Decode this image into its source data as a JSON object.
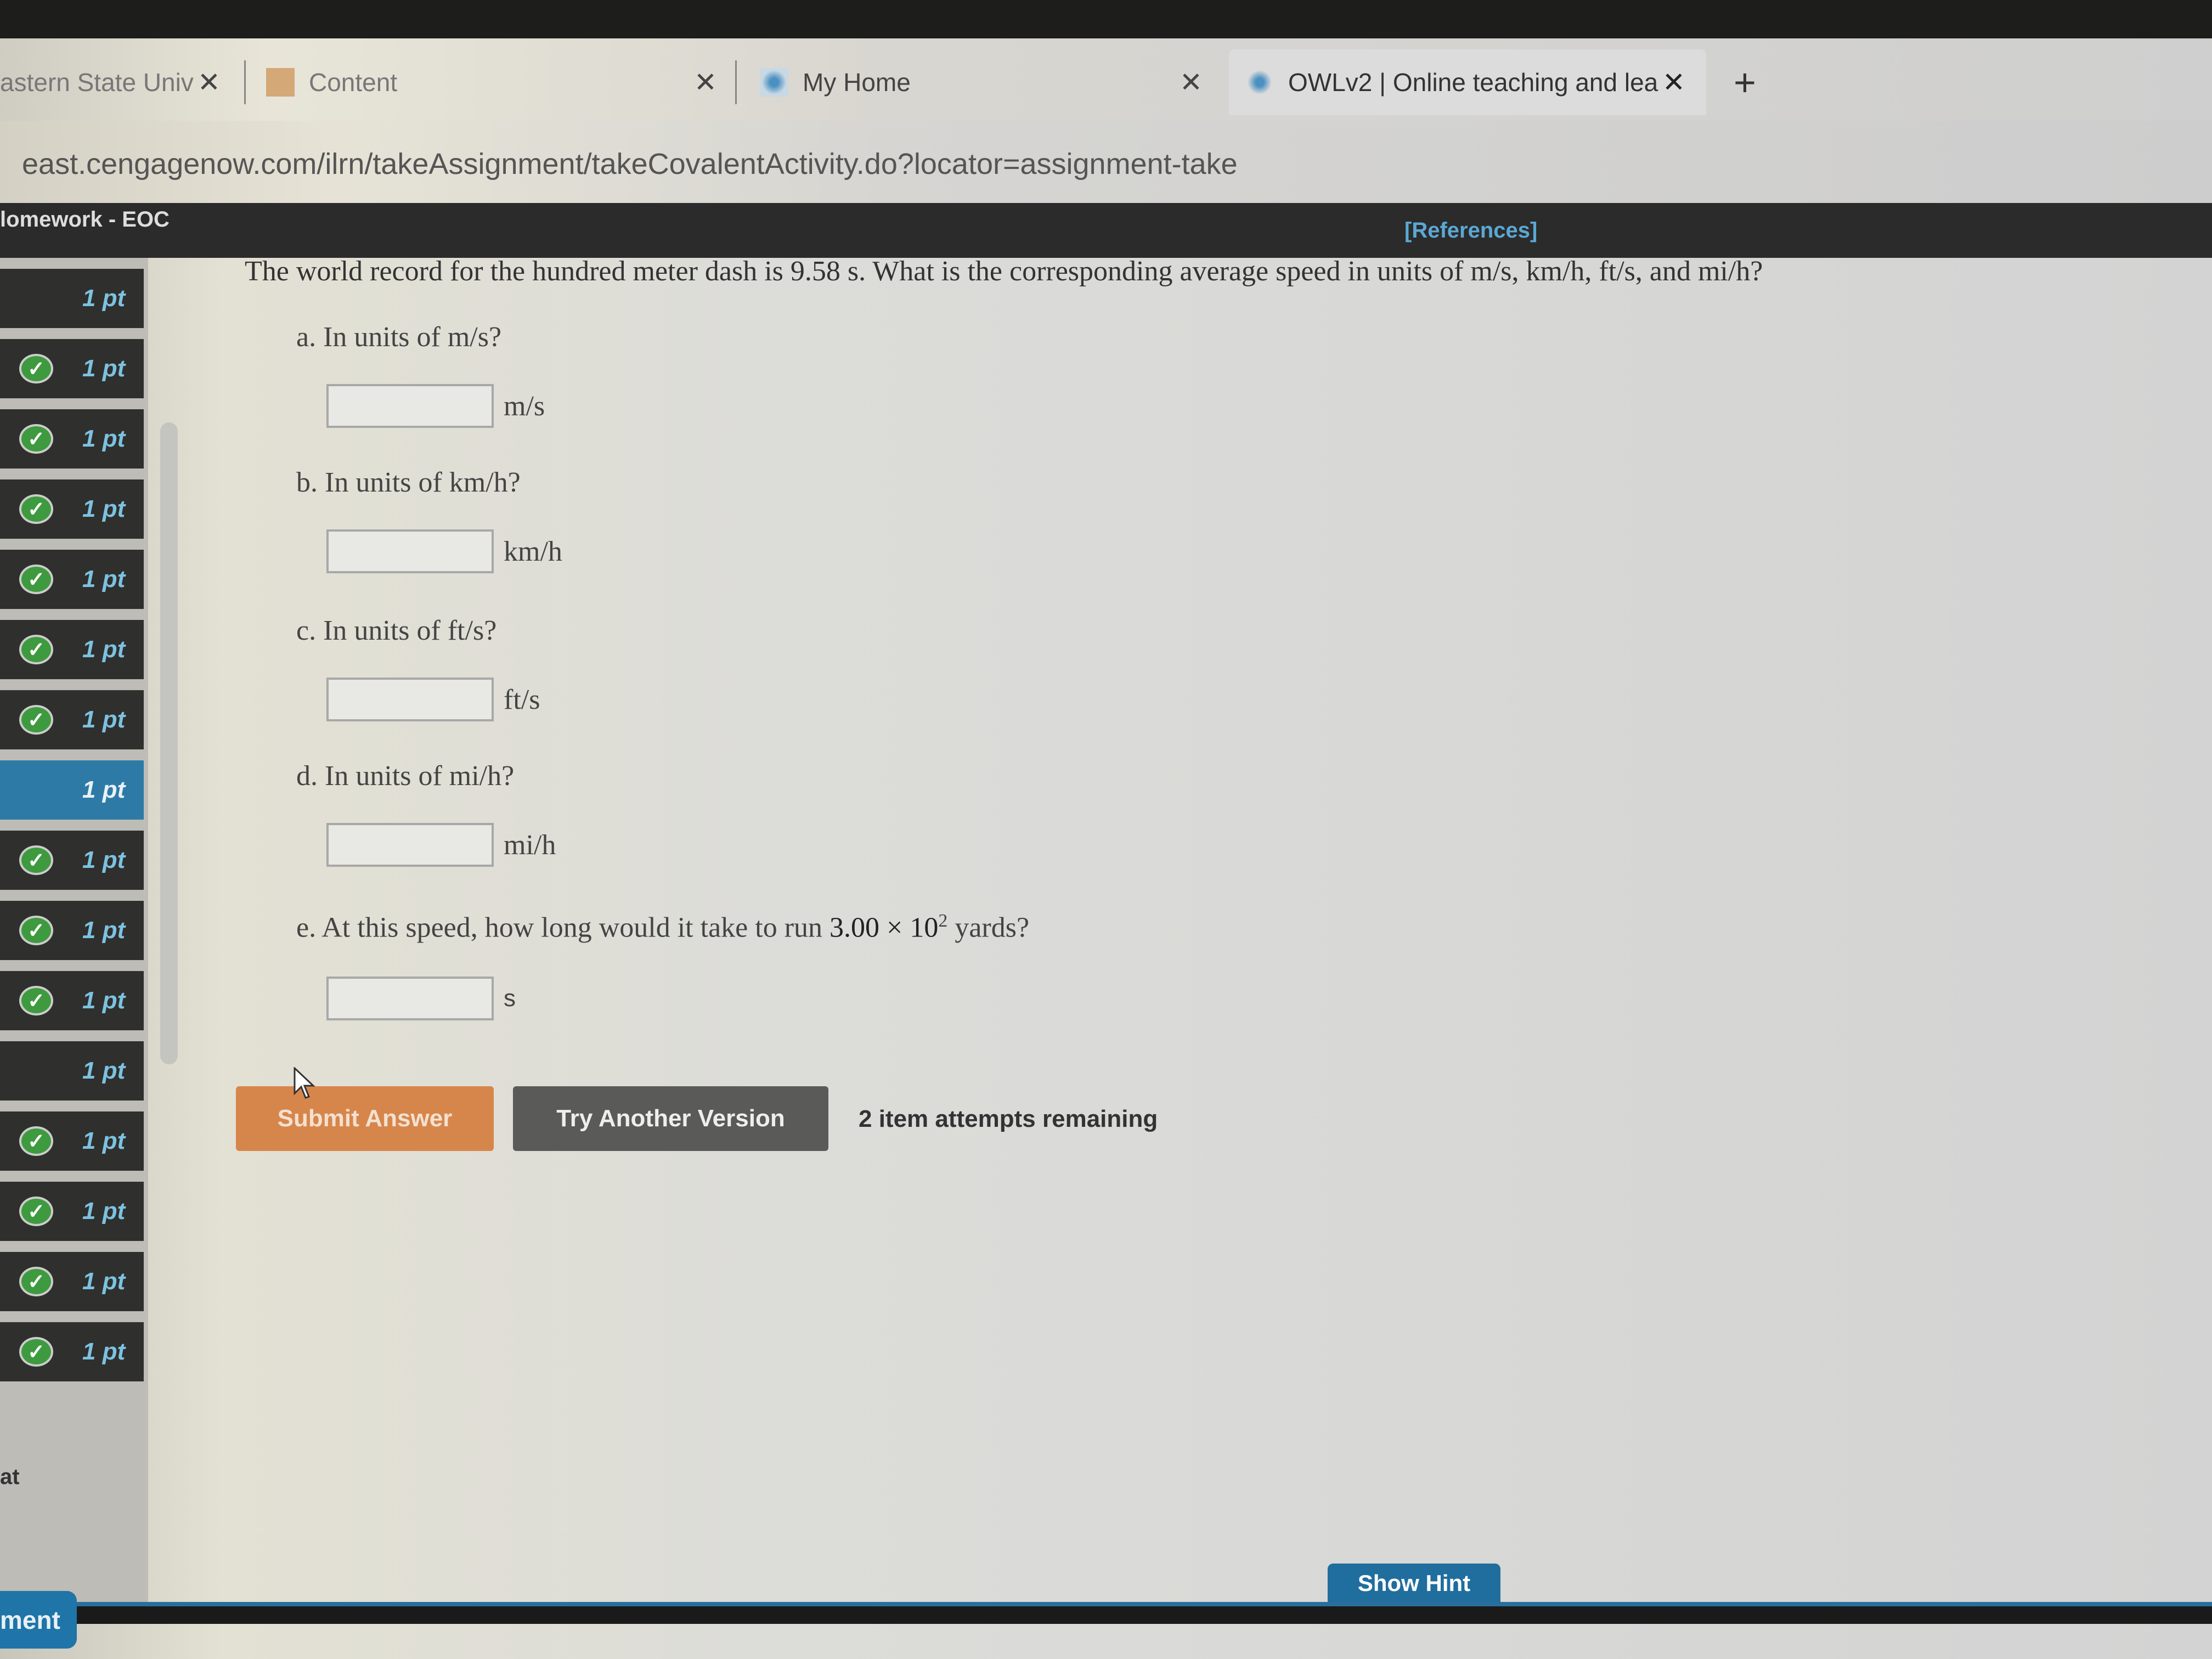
{
  "browser": {
    "tabs": [
      {
        "label": "astern State Univ",
        "active": false
      },
      {
        "label": "Content",
        "active": false
      },
      {
        "label": "My Home",
        "active": false
      },
      {
        "label": "OWLv2 | Online teaching and lea",
        "active": true
      }
    ],
    "close_glyph": "✕",
    "new_tab_glyph": "+",
    "url": "east.cengagenow.com/ilrn/takeAssignment/takeCovalentActivity.do?locator=assignment-take"
  },
  "header": {
    "title": "lomework - EOC",
    "references": "[References]"
  },
  "sidebar": {
    "items": [
      {
        "points": "1 pt",
        "status": "none"
      },
      {
        "points": "1 pt",
        "status": "correct"
      },
      {
        "points": "1 pt",
        "status": "correct"
      },
      {
        "points": "1 pt",
        "status": "correct"
      },
      {
        "points": "1 pt",
        "status": "correct"
      },
      {
        "points": "1 pt",
        "status": "correct"
      },
      {
        "points": "1 pt",
        "status": "correct"
      },
      {
        "points": "1 pt",
        "status": "current"
      },
      {
        "points": "1 pt",
        "status": "correct"
      },
      {
        "points": "1 pt",
        "status": "correct"
      },
      {
        "points": "1 pt",
        "status": "correct"
      },
      {
        "points": "1 pt",
        "status": "none"
      },
      {
        "points": "1 pt",
        "status": "correct"
      },
      {
        "points": "1 pt",
        "status": "correct"
      },
      {
        "points": "1 pt",
        "status": "correct"
      },
      {
        "points": "1 pt",
        "status": "correct"
      }
    ],
    "footer_text": "at",
    "bottom_button": "ment"
  },
  "question": {
    "text": "The world record for the hundred meter dash is 9.58 s. What is the corresponding average speed in units of m/s, km/h, ft/s, and mi/h?",
    "parts": [
      {
        "label": "a. In units of m/s?",
        "unit": "m/s",
        "value": ""
      },
      {
        "label": "b. In units of km/h?",
        "unit": "km/h",
        "value": ""
      },
      {
        "label": "c. In units of ft/s?",
        "unit": "ft/s",
        "value": ""
      },
      {
        "label": "d. In units of mi/h?",
        "unit": "mi/h",
        "value": ""
      },
      {
        "label_prefix": "e. At this speed, how long would it take to run ",
        "label_num": "3.00 × 10",
        "label_exp": "2",
        "label_suffix": " yards?",
        "unit": "s",
        "value": ""
      }
    ]
  },
  "actions": {
    "submit": "Submit Answer",
    "try_another": "Try Another Version",
    "attempts": "2 item attempts remaining",
    "show_hint": "Show Hint"
  },
  "colors": {
    "submit": "#d7864b",
    "try_another": "#5a5a58",
    "hint": "#1f6e9e",
    "current_item": "#2e7aa6",
    "correct": "#3e9a3e",
    "points_text": "#7cc2e0",
    "references": "#5aa8d4"
  }
}
